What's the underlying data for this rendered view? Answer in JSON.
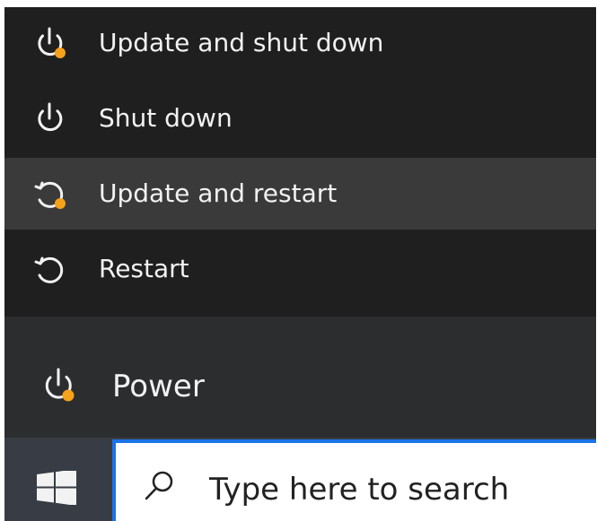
{
  "power_menu": {
    "items": [
      {
        "label": "Update and shut down",
        "icon": "update-shutdown-icon"
      },
      {
        "label": "Shut down",
        "icon": "power-icon"
      },
      {
        "label": "Update and restart",
        "icon": "update-restart-icon"
      },
      {
        "label": "Restart",
        "icon": "restart-icon"
      }
    ]
  },
  "start_panel": {
    "power_label": "Power",
    "power_icon": "power-update-icon"
  },
  "taskbar": {
    "start_icon": "windows-icon",
    "search_icon": "search-icon",
    "search_placeholder": "Type here to search"
  },
  "colors": {
    "menu_background": "#1f1f1f",
    "menu_hover": "#3a3a3a",
    "panel_background": "#2b2d2f",
    "taskbar_background": "#383c44",
    "search_border": "#1a73e8",
    "update_dot": "#f7a21b",
    "text": "#f2f2f2"
  }
}
